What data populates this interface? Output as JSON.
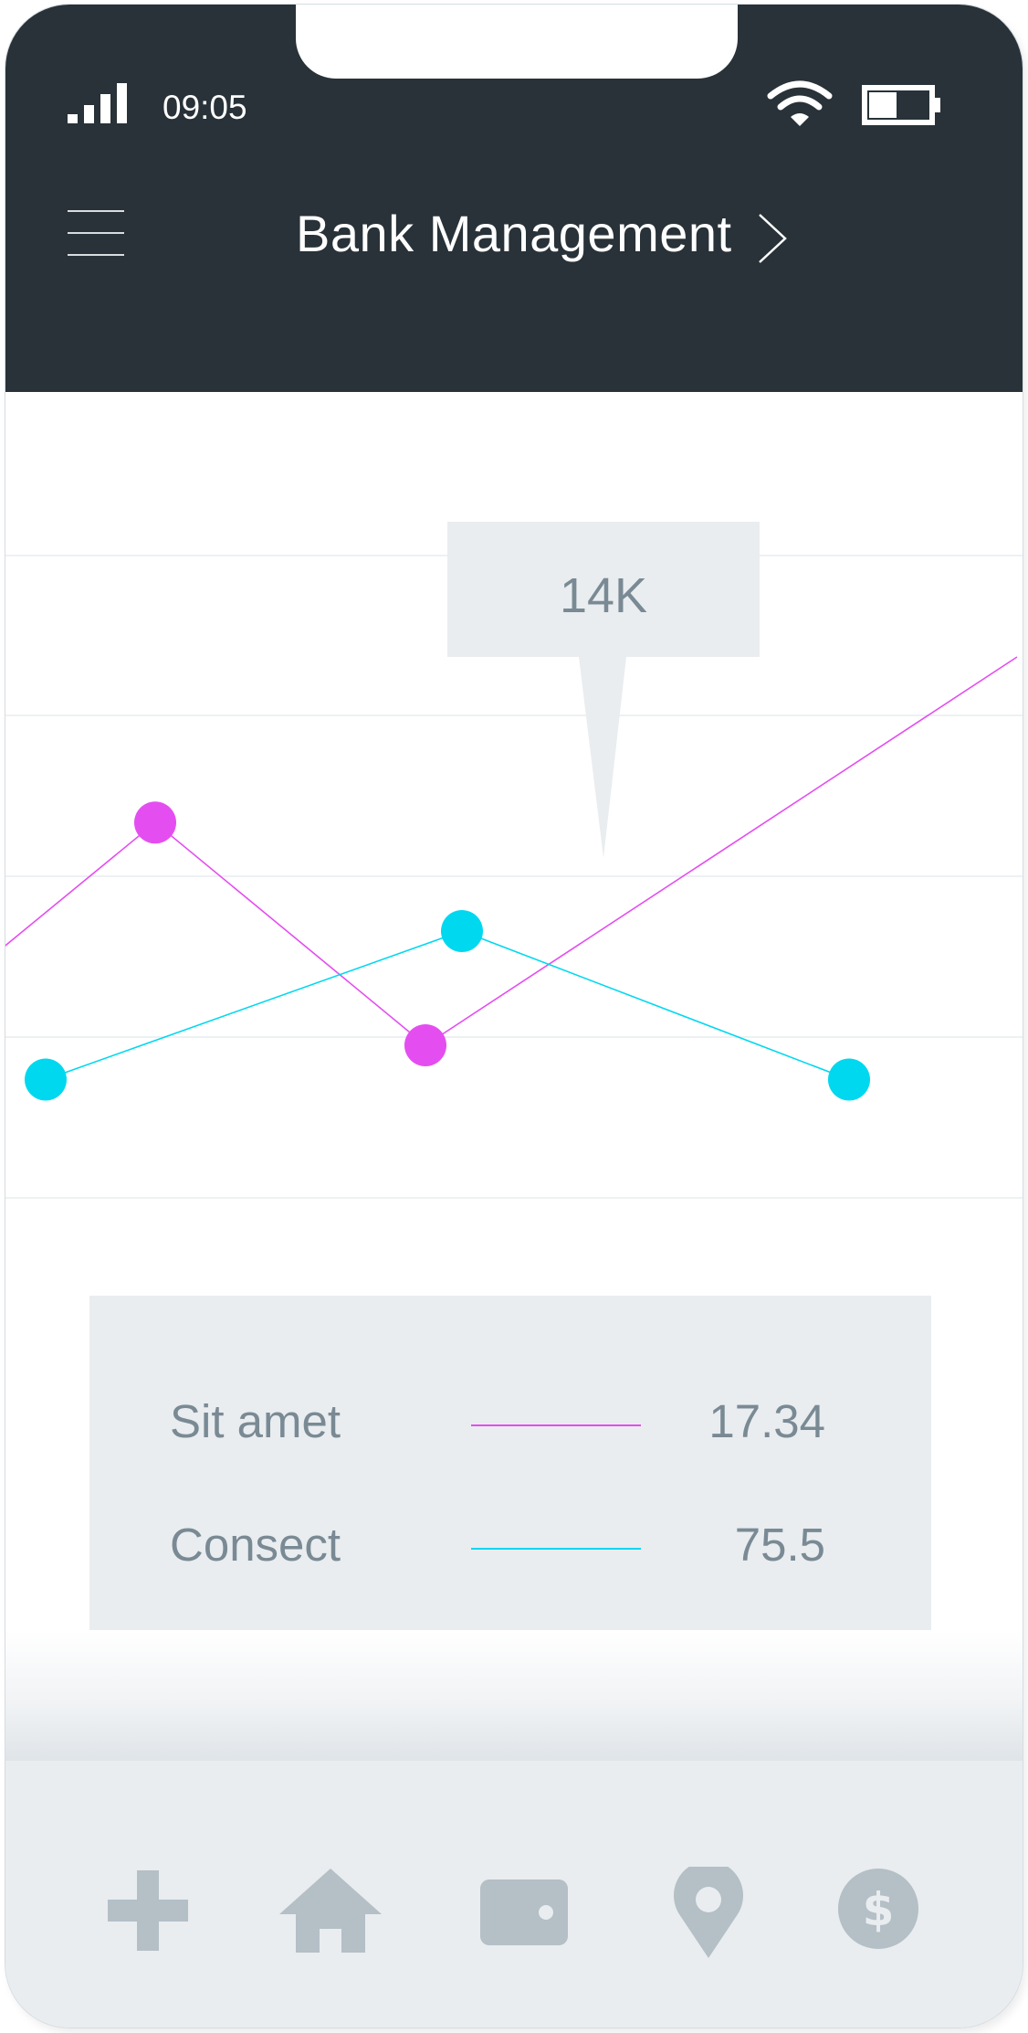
{
  "status_bar": {
    "time": "09:05"
  },
  "header": {
    "title": "Bank Management"
  },
  "chart_data": {
    "type": "line",
    "x": [
      0,
      1,
      2,
      3,
      4,
      5,
      6,
      7
    ],
    "series": [
      {
        "color": "#e44ef0",
        "values": [
          2.5,
          6.7,
          2.8,
          9.6
        ]
      },
      {
        "color": "#00d8f0",
        "values": [
          2.2,
          4.8,
          2.2
        ]
      }
    ],
    "tooltip": "14K",
    "grid": true
  },
  "legend": {
    "items": [
      {
        "label": "Sit amet",
        "value": "17.34",
        "color": "#e44ef0"
      },
      {
        "label": "Consect",
        "value": "75.5",
        "color": "#00d8f0"
      }
    ]
  },
  "tab_bar": {
    "items": [
      {
        "icon": "plus-icon"
      },
      {
        "icon": "home-icon"
      },
      {
        "icon": "wallet-icon"
      },
      {
        "icon": "location-pin-icon"
      },
      {
        "icon": "dollar-icon"
      }
    ],
    "icon_color": "#b4bfc6"
  },
  "colors": {
    "header_bg": "#283238",
    "panel_bg": "#e9edf0",
    "text_muted": "#7a8a94"
  }
}
